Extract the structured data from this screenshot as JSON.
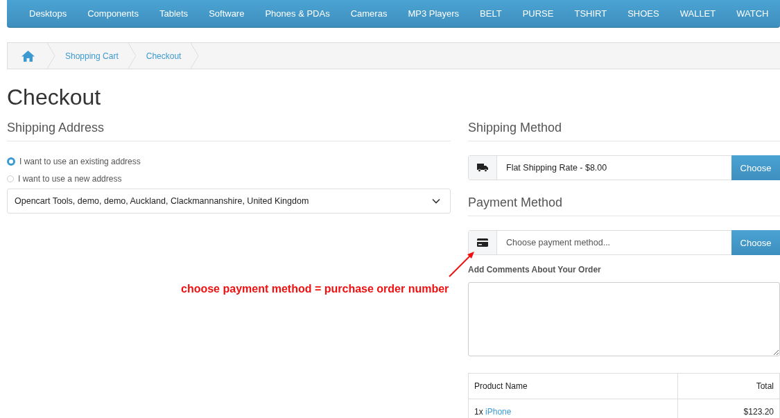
{
  "nav": [
    "Desktops",
    "Components",
    "Tablets",
    "Software",
    "Phones & PDAs",
    "Cameras",
    "MP3 Players",
    "BELT",
    "PURSE",
    "TSHIRT",
    "SHOES",
    "WALLET",
    "WATCH"
  ],
  "breadcrumb": [
    "Shopping Cart",
    "Checkout"
  ],
  "title": "Checkout",
  "shipping_address": {
    "heading": "Shipping Address",
    "options": [
      {
        "label": "I want to use an existing address",
        "selected": true
      },
      {
        "label": "I want to use a new address",
        "selected": false
      }
    ],
    "address": "Opencart Tools, demo, demo, Auckland, Clackmannanshire, United Kingdom"
  },
  "shipping_method": {
    "heading": "Shipping Method",
    "value": "Flat Shipping Rate - $8.00",
    "button": "Choose"
  },
  "payment_method": {
    "heading": "Payment Method",
    "placeholder": "Choose payment method...",
    "button": "Choose"
  },
  "comments": {
    "label": "Add Comments About Your Order"
  },
  "table": {
    "columns": [
      "Product Name",
      "Total"
    ],
    "rows": [
      {
        "qty": "1x",
        "product": "iPhone",
        "total": "$123.20"
      }
    ]
  },
  "annotation": "choose payment method = purchase order number"
}
